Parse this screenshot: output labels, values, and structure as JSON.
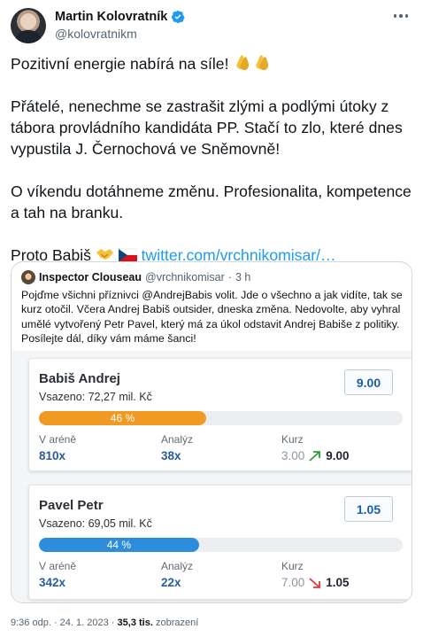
{
  "author": {
    "display_name": "Martin Kolovratník",
    "handle": "@kolovratnikm"
  },
  "tweet": {
    "line1": "Pozitivní energie nabírá na síle!",
    "para2": "Přátelé, nenechme se zastrašit zlými a podlými útoky z tábora provládního kandidáta PP. Stačí to zlo, které dnes vypustila J. Černochová ve Sněmovně!",
    "para3": "O víkendu dotáhneme změnu. Profesionalita, kompetence a tah na branku.",
    "para4_prefix": "Proto Babiš",
    "link": "twitter.com/vrchnikomisar/…"
  },
  "quote": {
    "name": "Inspector Clouseau",
    "handle": "@vrchnikomisar",
    "separator": "·",
    "time": "3 h",
    "text": "Pojďme všichni příznivci @AndrejBabis volit. Jde o všechno a jak vidíte, tak se kurz otočil. Včera Andrej Babiš outsider, dneska změna. Nedovolte, aby vyhral umělé vytvořený Petr Pavel, který má za úkol odstavit Andrej Babiše z politiky. Posílejte dál, díky vám máme šanci!"
  },
  "labels": {
    "arena": "V aréně",
    "analyses": "Analýz",
    "kurz": "Kurz"
  },
  "candidates": [
    {
      "name": "Babiš Andrej",
      "staked": "Vsazeno: 72,27 mil. Kč",
      "odds": "9.00",
      "share_label": "46 %",
      "share": 46,
      "arena": "810x",
      "analyses": "38x",
      "kurz_old": "3.00",
      "kurz_new": "9.00",
      "trend": "up",
      "bar_color": "#f09a23",
      "trend_color": "#2e9b3b"
    },
    {
      "name": "Pavel Petr",
      "staked": "Vsazeno: 69,05 mil. Kč",
      "odds": "1.05",
      "share_label": "44 %",
      "share": 44,
      "arena": "342x",
      "analyses": "22x",
      "kurz_old": "7.00",
      "kurz_new": "1.05",
      "trend": "down",
      "bar_color": "#2d8ddd",
      "trend_color": "#d93b3b"
    }
  ],
  "footer": {
    "time": "9:36 odp.",
    "separator": "·",
    "date": "24. 1. 2023",
    "views": "35,3 tis.",
    "views_label": "zobrazení"
  },
  "colors": {
    "link": "#1d9bf0",
    "verified": "#1d9bf0",
    "odds_text": "#1a5fa9"
  }
}
